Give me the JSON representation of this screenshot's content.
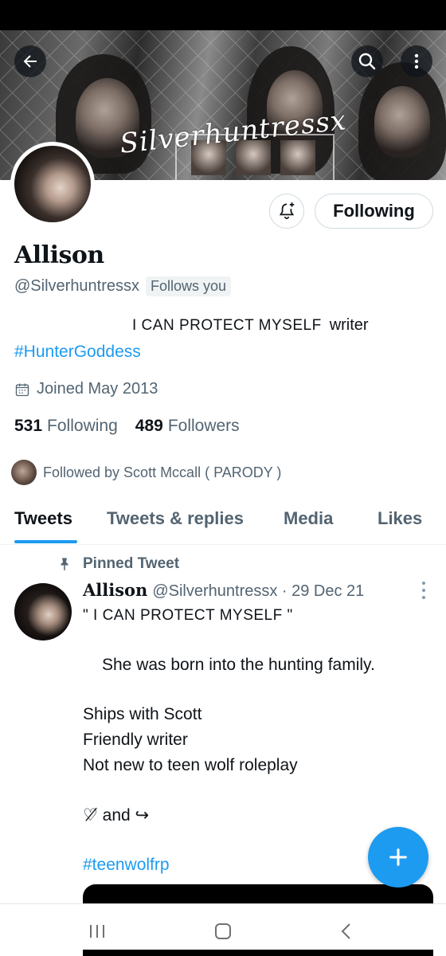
{
  "banner": {
    "watermark": "Silverhuntressx"
  },
  "header": {
    "back_icon": "arrow-left-icon",
    "search_icon": "search-icon",
    "more_icon": "more-vertical-icon"
  },
  "profile": {
    "name": "Allison",
    "handle": "@Silverhuntressx",
    "follows_you": "Follows you",
    "following_button": "Following",
    "bio_caps": "I CAN PROTECT MYSELF",
    "bio_rest": "writer",
    "hashtag": "#HunterGoddess",
    "joined": "Joined May 2013",
    "following_count": "531",
    "following_label": "Following",
    "followers_count": "489",
    "followers_label": "Followers",
    "followed_by": "Followed by Scott Mccall ( PARODY )"
  },
  "tabs": [
    "Tweets",
    "Tweets & replies",
    "Media",
    "Likes"
  ],
  "pinned_tweet": {
    "label": "Pinned Tweet",
    "name": "Allison",
    "handle_date": "@Silverhuntressx · 29 Dec 21",
    "line1": "\" I CAN PROTECT MYSELF \"",
    "line2": "She was born into the hunting family.",
    "line3": "Ships with Scott",
    "line4": "Friendly writer",
    "line5": "Not new to teen wolf roleplay",
    "line6": "♡̸ and ↪",
    "hashtag": "#teenwolfrp"
  },
  "colors": {
    "accent": "#1d9bf0",
    "text": "#0f1419",
    "secondary": "#536471"
  }
}
